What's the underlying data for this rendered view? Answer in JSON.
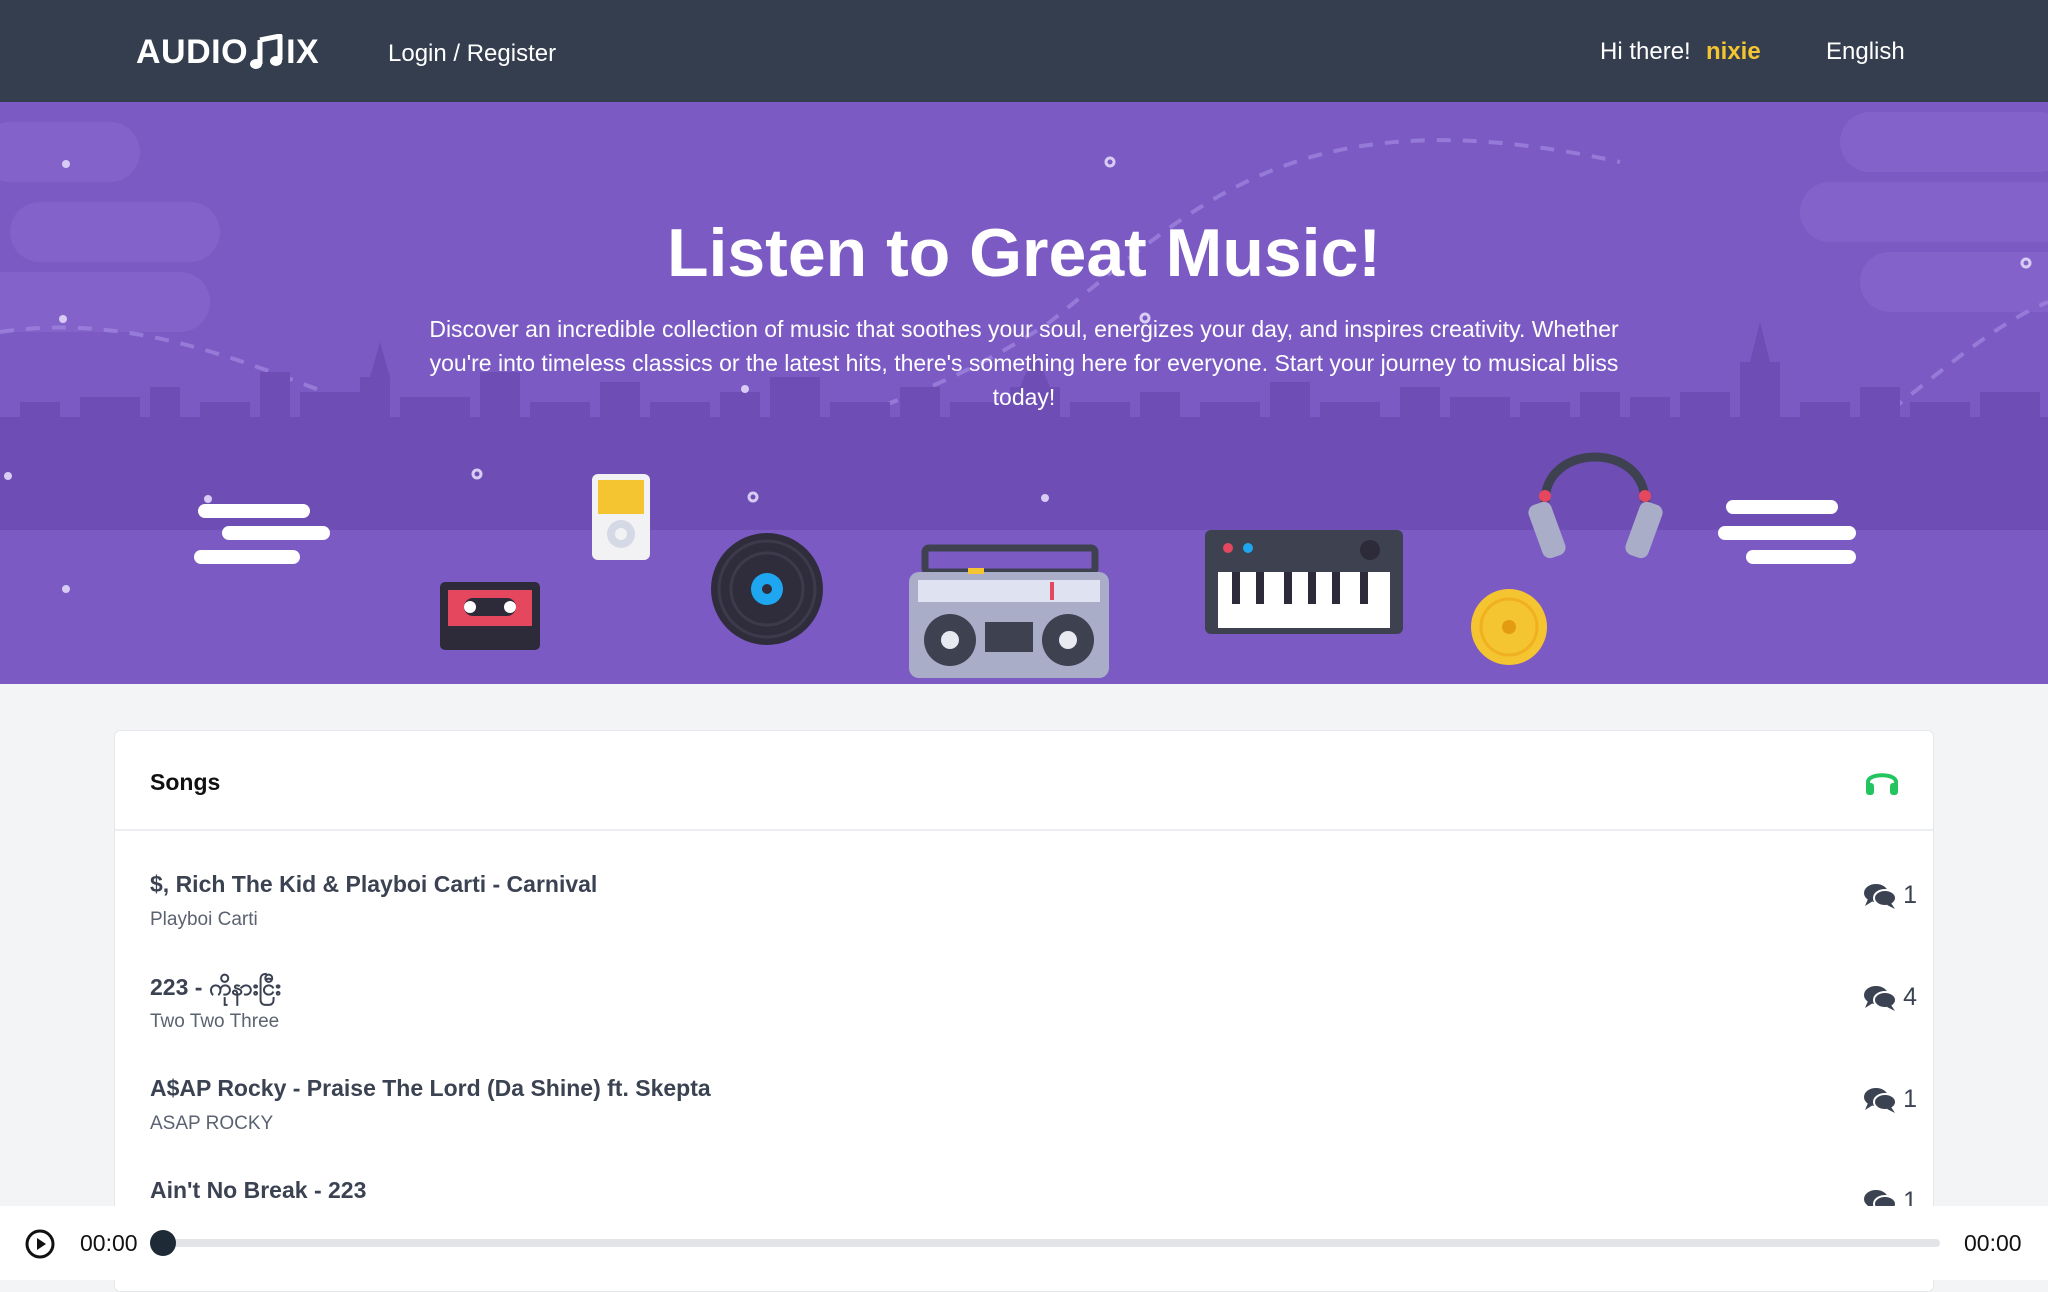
{
  "navbar": {
    "brand_left": "AUDIO",
    "brand_right": "IX",
    "login_label": "Login / Register",
    "greeting": "Hi there!",
    "username": "nixie",
    "language": "English"
  },
  "hero": {
    "title": "Listen to Great Music!",
    "description": "Discover an incredible collection of music that soothes your soul, energizes your day, and inspires creativity. Whether you're into timeless classics or the latest hits, there's something here for everyone. Start your journey to musical bliss today!"
  },
  "songs": {
    "header": "Songs",
    "icon": "headphones-icon",
    "items": [
      {
        "title": "$, Rich The Kid & Playboi Carti - Carnival",
        "artist": "Playboi Carti",
        "comments": "1"
      },
      {
        "title": "223 - ကိုနားငြီး",
        "artist": "Two Two Three",
        "comments": "4"
      },
      {
        "title": "A$AP Rocky - Praise The Lord (Da Shine) ft. Skepta",
        "artist": "ASAP ROCKY",
        "comments": "1"
      },
      {
        "title": "Ain't No Break - 223",
        "artist": "",
        "comments": "1"
      }
    ]
  },
  "player": {
    "current_time": "00:00",
    "total_time": "00:00",
    "progress": 0
  },
  "colors": {
    "navbar": "#343e4e",
    "hero": "#7b5ac4",
    "username": "#f5c431",
    "headphones_icon": "#22c55e"
  }
}
